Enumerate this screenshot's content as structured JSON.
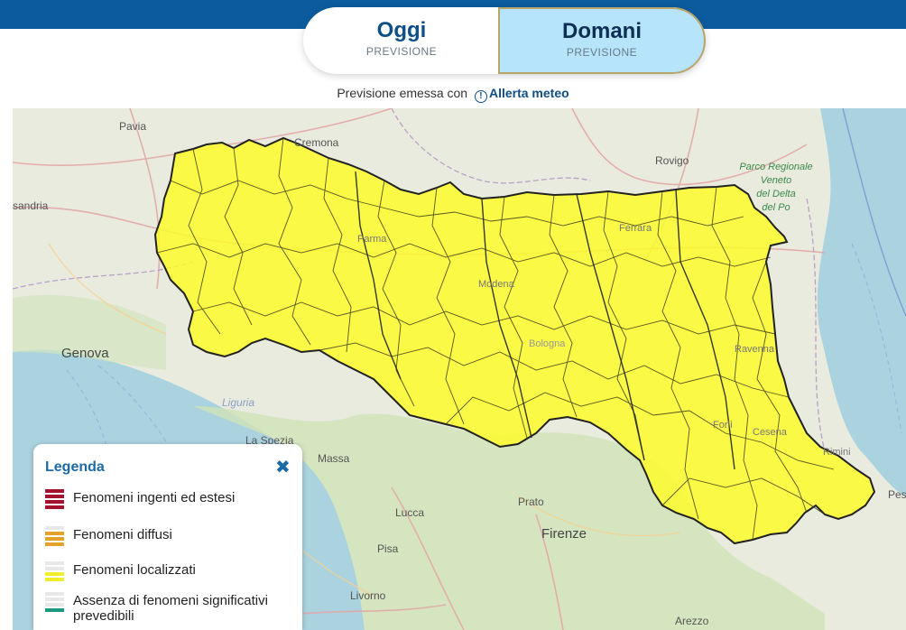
{
  "header": {
    "tabs": [
      {
        "title": "Oggi",
        "subtitle": "PREVISIONE",
        "active": false
      },
      {
        "title": "Domani",
        "subtitle": "PREVISIONE",
        "active": true
      }
    ]
  },
  "issued": {
    "prefix": "Previsione emessa con",
    "link_label": "Allerta meteo",
    "icon": "info-circle-icon"
  },
  "map": {
    "alert_color": "#fbfb2c",
    "labels": {
      "pavia": "Pavia",
      "cremona": "Cremona",
      "rovigo": "Rovigo",
      "parco1": "Parco Regionale",
      "parco2": "Veneto",
      "parco3": "del Delta",
      "parco4": "del Po",
      "alessandria": "sandria",
      "parma": "Parma",
      "ferrara": "Ferrara",
      "modena": "Modena",
      "bologna": "Bologna",
      "ravenna": "Ravenna",
      "genova": "Genova",
      "liguria": "Liguria",
      "forli": "Forlì",
      "cesena": "Cesena",
      "rimini": "Rimini",
      "laspezia": "La Spezia",
      "massa": "Massa",
      "prato": "Prato",
      "lucca": "Lucca",
      "firenze": "Firenze",
      "pisa": "Pisa",
      "livorno": "Livorno",
      "arezzo": "Arezzo",
      "pesaro": "Pes"
    }
  },
  "legend": {
    "title": "Legenda",
    "close_icon": "close-icon",
    "items": [
      {
        "label": "Fenomeni ingenti ed estesi",
        "color": "#a3122e"
      },
      {
        "label": "Fenomeni diffusi",
        "color": "#e3a32a"
      },
      {
        "label": "Fenomeni localizzati",
        "color": "#f2ee2c"
      },
      {
        "label": "Assenza di fenomeni significativi prevedibili",
        "color": "#1d9a7d"
      }
    ]
  }
}
